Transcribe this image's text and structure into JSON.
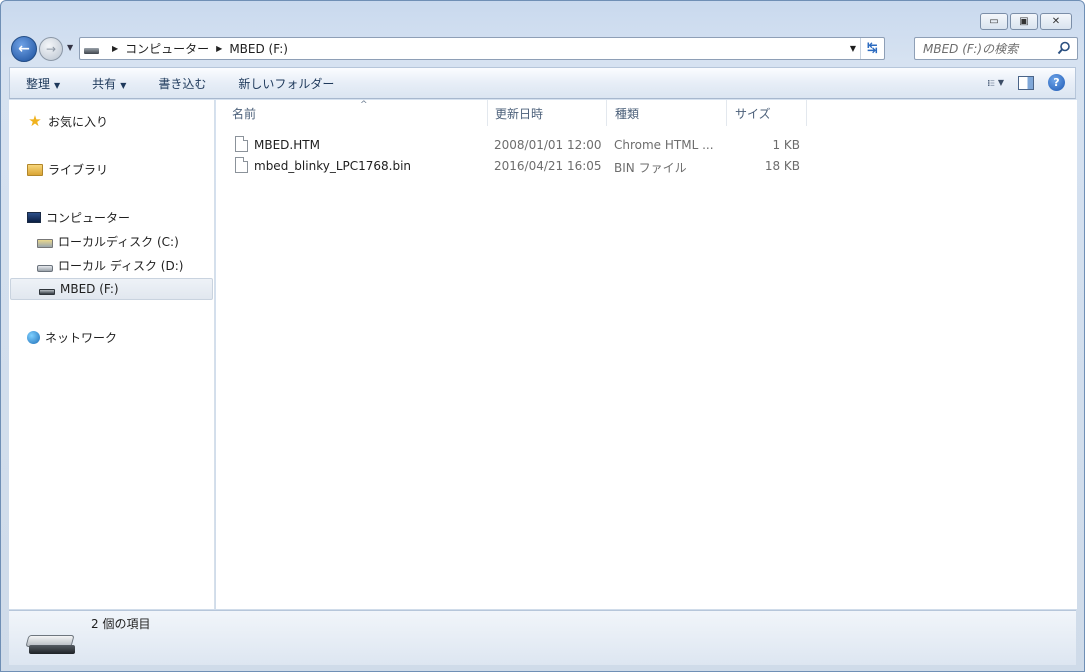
{
  "window": {
    "caption": {
      "minimize": "▭",
      "maximize": "▣",
      "close": "✕"
    }
  },
  "address": {
    "crumbs": [
      "コンピューター",
      "MBED (F:)"
    ]
  },
  "search": {
    "placeholder": "MBED (F:)の検索"
  },
  "toolbar": {
    "organize": "整理",
    "share": "共有",
    "burn": "書き込む",
    "new_folder": "新しいフォルダー"
  },
  "sidebar": {
    "favorites": "お気に入り",
    "libraries": "ライブラリ",
    "computer": "コンピューター",
    "drive_c": "ローカルディスク (C:)",
    "drive_d": "ローカル ディスク (D:)",
    "drive_f": "MBED (F:)",
    "network": "ネットワーク"
  },
  "columns": {
    "name": "名前",
    "date": "更新日時",
    "type": "種類",
    "size": "サイズ"
  },
  "files": [
    {
      "name": "MBED.HTM",
      "date": "2008/01/01 12:00",
      "type": "Chrome HTML ...",
      "size": "1 KB"
    },
    {
      "name": "mbed_blinky_LPC1768.bin",
      "date": "2016/04/21 16:05",
      "type": "BIN ファイル",
      "size": "18 KB"
    }
  ],
  "details": {
    "count": "2 個の項目"
  }
}
